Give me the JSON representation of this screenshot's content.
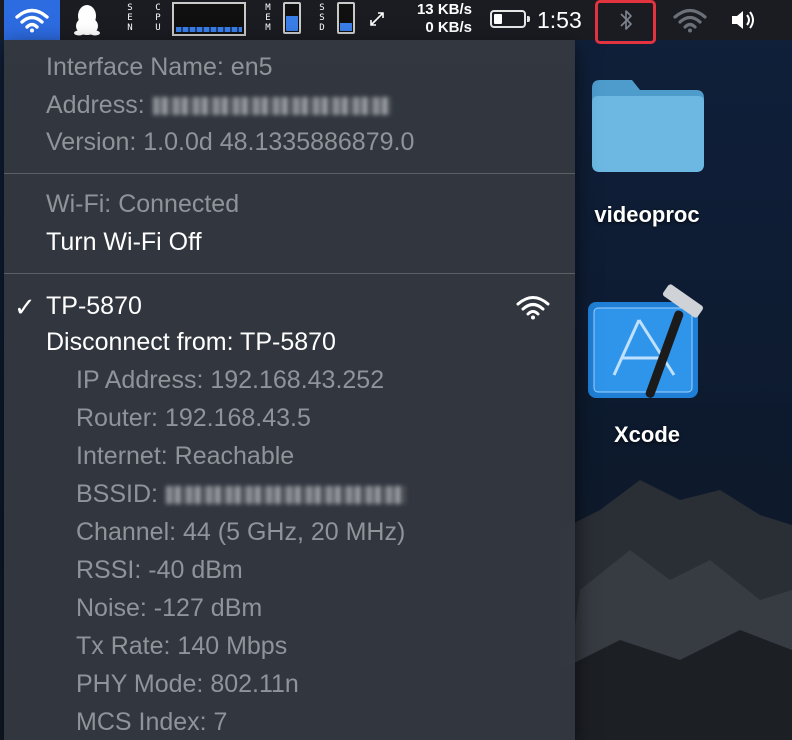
{
  "menubar": {
    "sen_label": "S\nE\nN",
    "cpu_label": "C\nP\nU",
    "mem_label": "M\nE\nM",
    "ssd_label": "S\nS\nD",
    "mem_level": 0.55,
    "ssd_level": 0.3,
    "net_up": "13 KB/s",
    "net_down": "0 KB/s",
    "battery_level": 0.3,
    "clock": "1:53",
    "icons": [
      "wifi-icon",
      "qq-penguin-icon",
      "expand-arrows-icon",
      "bluetooth-icon",
      "wifi-inactive-icon",
      "volume-icon"
    ]
  },
  "menu": {
    "interface_name": "Interface Name: en5",
    "address_label": "Address:",
    "version": "Version: 1.0.0d 48.1335886879.0",
    "wifi_status": "Wi-Fi: Connected",
    "turn_off": "Turn Wi-Fi Off",
    "network_name": "TP-5870",
    "check": "✓",
    "disconnect": "Disconnect from: TP-5870",
    "details": [
      "IP Address: 192.168.43.252",
      "Router: 192.168.43.5",
      "Internet: Reachable",
      "BSSID:",
      "Channel: 44 (5 GHz, 20 MHz)",
      "RSSI: -40 dBm",
      "Noise: -127 dBm",
      "Tx Rate: 140 Mbps",
      "PHY Mode: 802.11n",
      "MCS Index: 7"
    ]
  },
  "desktop": {
    "folder_label": "videoproc",
    "app_label": "Xcode"
  },
  "colors": {
    "menubar_bg": "#1a1c22",
    "wifi_highlight": "#2d6be1",
    "bluetooth_highlight": "#e3333f",
    "menu_bg": "#343840",
    "dim_text": "#8f949b",
    "folder_blue": "#5aa9d8"
  }
}
